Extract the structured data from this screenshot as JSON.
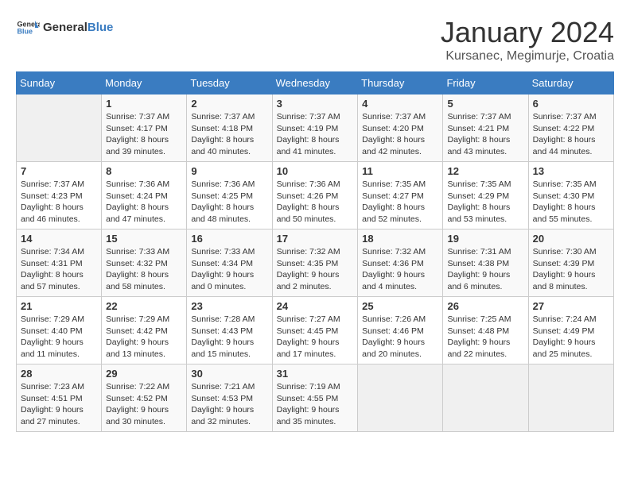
{
  "header": {
    "logo_general": "General",
    "logo_blue": "Blue",
    "title": "January 2024",
    "subtitle": "Kursanec, Megimurje, Croatia"
  },
  "weekdays": [
    "Sunday",
    "Monday",
    "Tuesday",
    "Wednesday",
    "Thursday",
    "Friday",
    "Saturday"
  ],
  "weeks": [
    [
      {
        "day": "",
        "info": ""
      },
      {
        "day": "1",
        "info": "Sunrise: 7:37 AM\nSunset: 4:17 PM\nDaylight: 8 hours\nand 39 minutes."
      },
      {
        "day": "2",
        "info": "Sunrise: 7:37 AM\nSunset: 4:18 PM\nDaylight: 8 hours\nand 40 minutes."
      },
      {
        "day": "3",
        "info": "Sunrise: 7:37 AM\nSunset: 4:19 PM\nDaylight: 8 hours\nand 41 minutes."
      },
      {
        "day": "4",
        "info": "Sunrise: 7:37 AM\nSunset: 4:20 PM\nDaylight: 8 hours\nand 42 minutes."
      },
      {
        "day": "5",
        "info": "Sunrise: 7:37 AM\nSunset: 4:21 PM\nDaylight: 8 hours\nand 43 minutes."
      },
      {
        "day": "6",
        "info": "Sunrise: 7:37 AM\nSunset: 4:22 PM\nDaylight: 8 hours\nand 44 minutes."
      }
    ],
    [
      {
        "day": "7",
        "info": "Sunrise: 7:37 AM\nSunset: 4:23 PM\nDaylight: 8 hours\nand 46 minutes."
      },
      {
        "day": "8",
        "info": "Sunrise: 7:36 AM\nSunset: 4:24 PM\nDaylight: 8 hours\nand 47 minutes."
      },
      {
        "day": "9",
        "info": "Sunrise: 7:36 AM\nSunset: 4:25 PM\nDaylight: 8 hours\nand 48 minutes."
      },
      {
        "day": "10",
        "info": "Sunrise: 7:36 AM\nSunset: 4:26 PM\nDaylight: 8 hours\nand 50 minutes."
      },
      {
        "day": "11",
        "info": "Sunrise: 7:35 AM\nSunset: 4:27 PM\nDaylight: 8 hours\nand 52 minutes."
      },
      {
        "day": "12",
        "info": "Sunrise: 7:35 AM\nSunset: 4:29 PM\nDaylight: 8 hours\nand 53 minutes."
      },
      {
        "day": "13",
        "info": "Sunrise: 7:35 AM\nSunset: 4:30 PM\nDaylight: 8 hours\nand 55 minutes."
      }
    ],
    [
      {
        "day": "14",
        "info": "Sunrise: 7:34 AM\nSunset: 4:31 PM\nDaylight: 8 hours\nand 57 minutes."
      },
      {
        "day": "15",
        "info": "Sunrise: 7:33 AM\nSunset: 4:32 PM\nDaylight: 8 hours\nand 58 minutes."
      },
      {
        "day": "16",
        "info": "Sunrise: 7:33 AM\nSunset: 4:34 PM\nDaylight: 9 hours\nand 0 minutes."
      },
      {
        "day": "17",
        "info": "Sunrise: 7:32 AM\nSunset: 4:35 PM\nDaylight: 9 hours\nand 2 minutes."
      },
      {
        "day": "18",
        "info": "Sunrise: 7:32 AM\nSunset: 4:36 PM\nDaylight: 9 hours\nand 4 minutes."
      },
      {
        "day": "19",
        "info": "Sunrise: 7:31 AM\nSunset: 4:38 PM\nDaylight: 9 hours\nand 6 minutes."
      },
      {
        "day": "20",
        "info": "Sunrise: 7:30 AM\nSunset: 4:39 PM\nDaylight: 9 hours\nand 8 minutes."
      }
    ],
    [
      {
        "day": "21",
        "info": "Sunrise: 7:29 AM\nSunset: 4:40 PM\nDaylight: 9 hours\nand 11 minutes."
      },
      {
        "day": "22",
        "info": "Sunrise: 7:29 AM\nSunset: 4:42 PM\nDaylight: 9 hours\nand 13 minutes."
      },
      {
        "day": "23",
        "info": "Sunrise: 7:28 AM\nSunset: 4:43 PM\nDaylight: 9 hours\nand 15 minutes."
      },
      {
        "day": "24",
        "info": "Sunrise: 7:27 AM\nSunset: 4:45 PM\nDaylight: 9 hours\nand 17 minutes."
      },
      {
        "day": "25",
        "info": "Sunrise: 7:26 AM\nSunset: 4:46 PM\nDaylight: 9 hours\nand 20 minutes."
      },
      {
        "day": "26",
        "info": "Sunrise: 7:25 AM\nSunset: 4:48 PM\nDaylight: 9 hours\nand 22 minutes."
      },
      {
        "day": "27",
        "info": "Sunrise: 7:24 AM\nSunset: 4:49 PM\nDaylight: 9 hours\nand 25 minutes."
      }
    ],
    [
      {
        "day": "28",
        "info": "Sunrise: 7:23 AM\nSunset: 4:51 PM\nDaylight: 9 hours\nand 27 minutes."
      },
      {
        "day": "29",
        "info": "Sunrise: 7:22 AM\nSunset: 4:52 PM\nDaylight: 9 hours\nand 30 minutes."
      },
      {
        "day": "30",
        "info": "Sunrise: 7:21 AM\nSunset: 4:53 PM\nDaylight: 9 hours\nand 32 minutes."
      },
      {
        "day": "31",
        "info": "Sunrise: 7:19 AM\nSunset: 4:55 PM\nDaylight: 9 hours\nand 35 minutes."
      },
      {
        "day": "",
        "info": ""
      },
      {
        "day": "",
        "info": ""
      },
      {
        "day": "",
        "info": ""
      }
    ]
  ]
}
